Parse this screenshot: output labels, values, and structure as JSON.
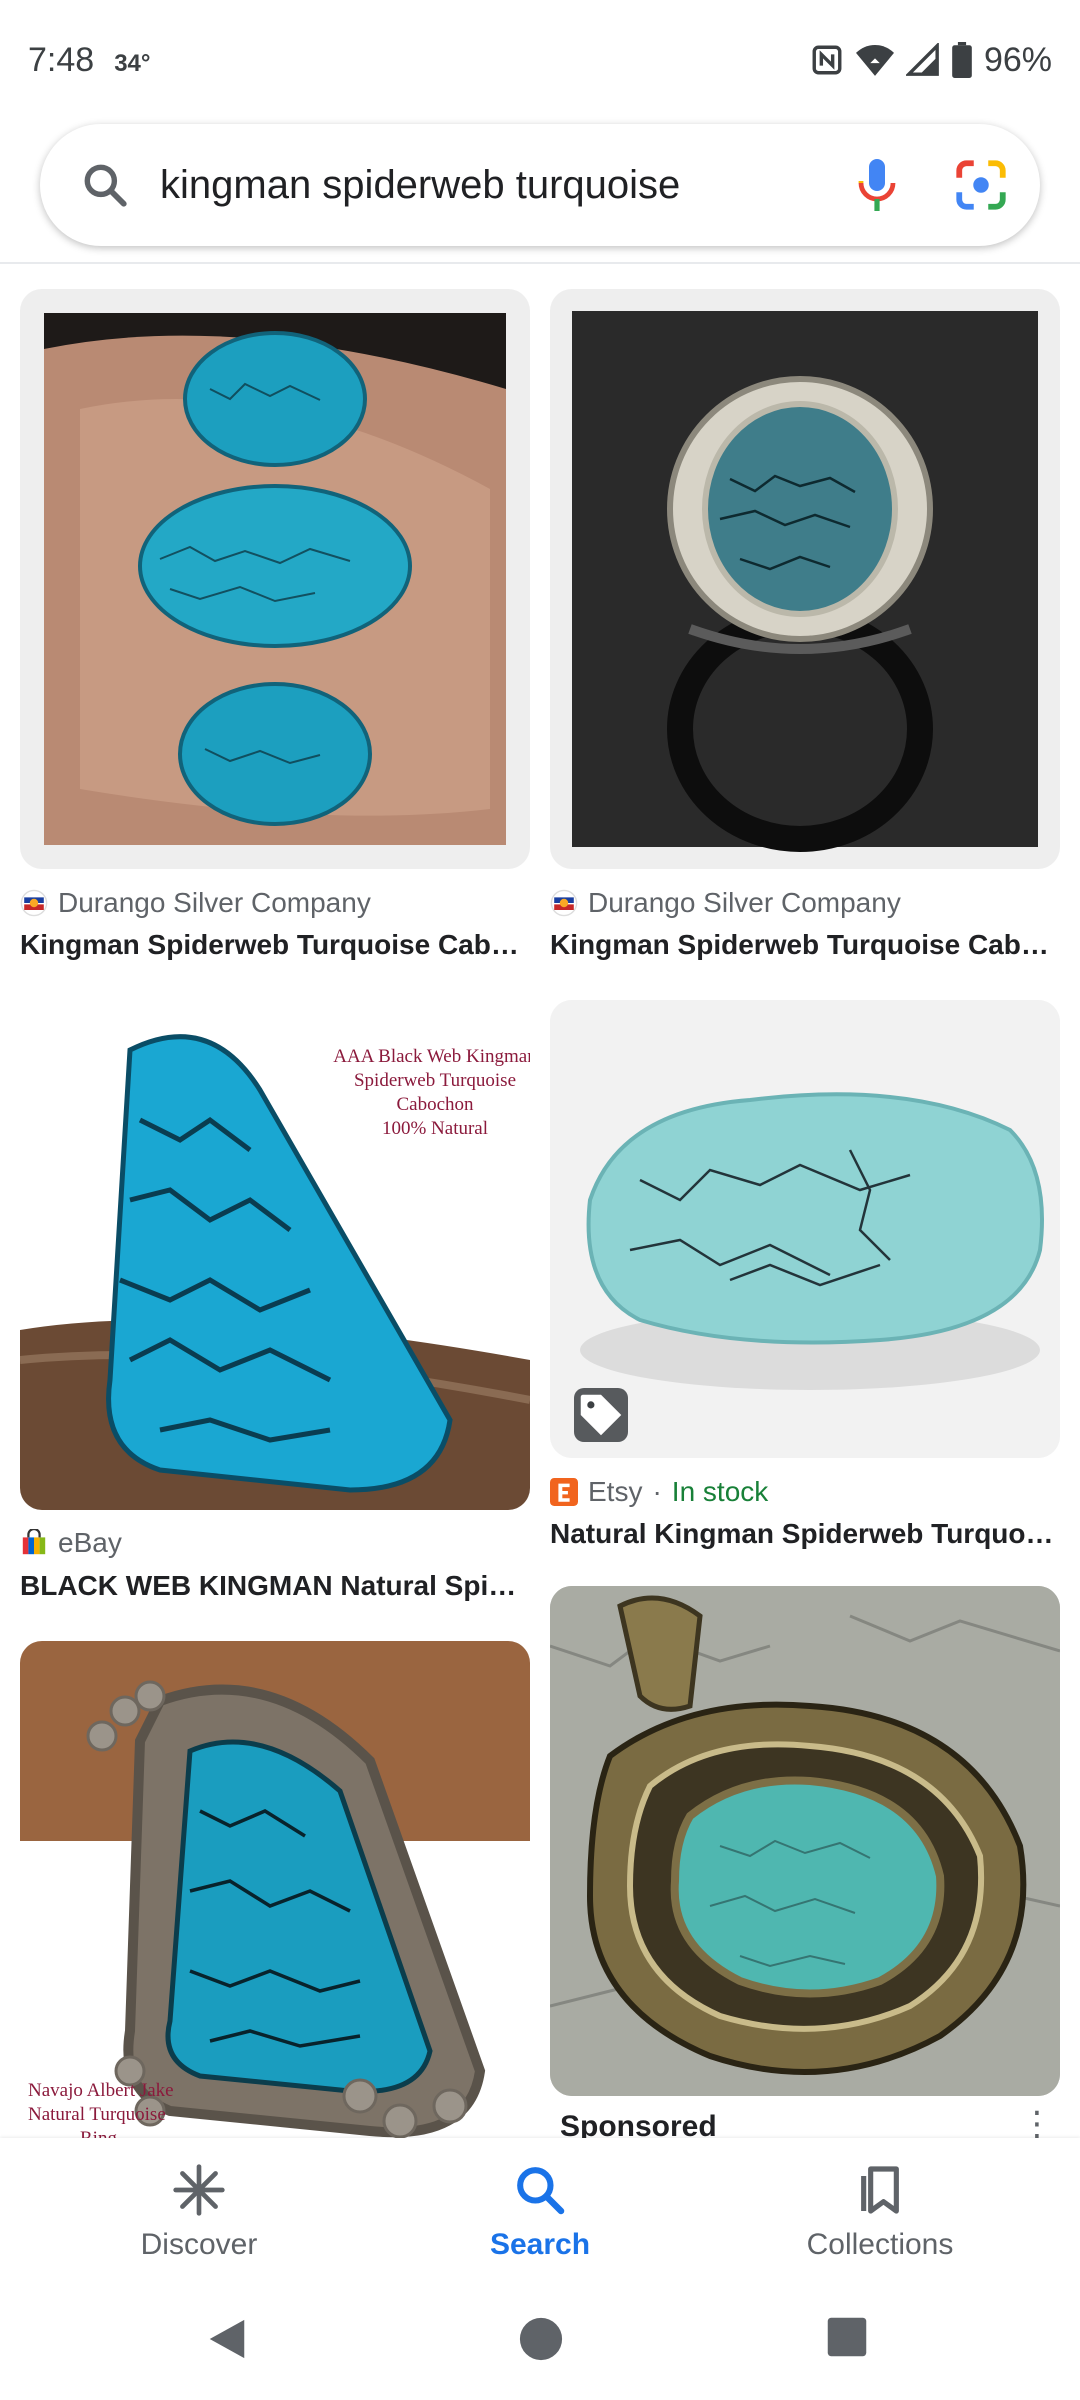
{
  "status": {
    "time": "7:48",
    "temp": "34°",
    "battery": "96%",
    "icons": [
      "nfc-icon",
      "wifi-icon",
      "signal-icon",
      "battery-icon"
    ]
  },
  "search": {
    "query": "kingman spiderweb turquoise",
    "icons": [
      "search-icon",
      "mic-icon",
      "lens-icon"
    ]
  },
  "results": [
    {
      "source": "Durango Silver Company",
      "title": "Kingman Spiderweb Turquoise Cabo…"
    },
    {
      "source": "Durango Silver Company",
      "title": "Kingman Spiderweb Turquoise Cabo…"
    },
    {
      "source": "eBay",
      "title": "BLACK WEB KINGMAN Natural Spide…",
      "image_text": [
        "AAA Black Web Kingman",
        "Spiderweb Turquoise",
        "Cabochon",
        "100% Natural"
      ]
    },
    {
      "source": "Etsy",
      "availability": "In stock",
      "separator": "·",
      "title": "Natural Kingman Spiderweb Turquoi…"
    },
    {
      "image_text": [
        "Navajo Albert Jake",
        "Natural Turquoise",
        "Ring"
      ]
    },
    {
      "label": "Sponsored",
      "menu": "⋮"
    }
  ],
  "bottom_nav": {
    "items": [
      {
        "label": "Discover",
        "icon": "asterisk-icon"
      },
      {
        "label": "Search",
        "icon": "search-icon",
        "active": true
      },
      {
        "label": "Collections",
        "icon": "bookmarks-icon"
      }
    ]
  },
  "colors": {
    "accent": "#1a73e8",
    "turquoise": "#1fa4c4",
    "in_stock": "#188038"
  }
}
